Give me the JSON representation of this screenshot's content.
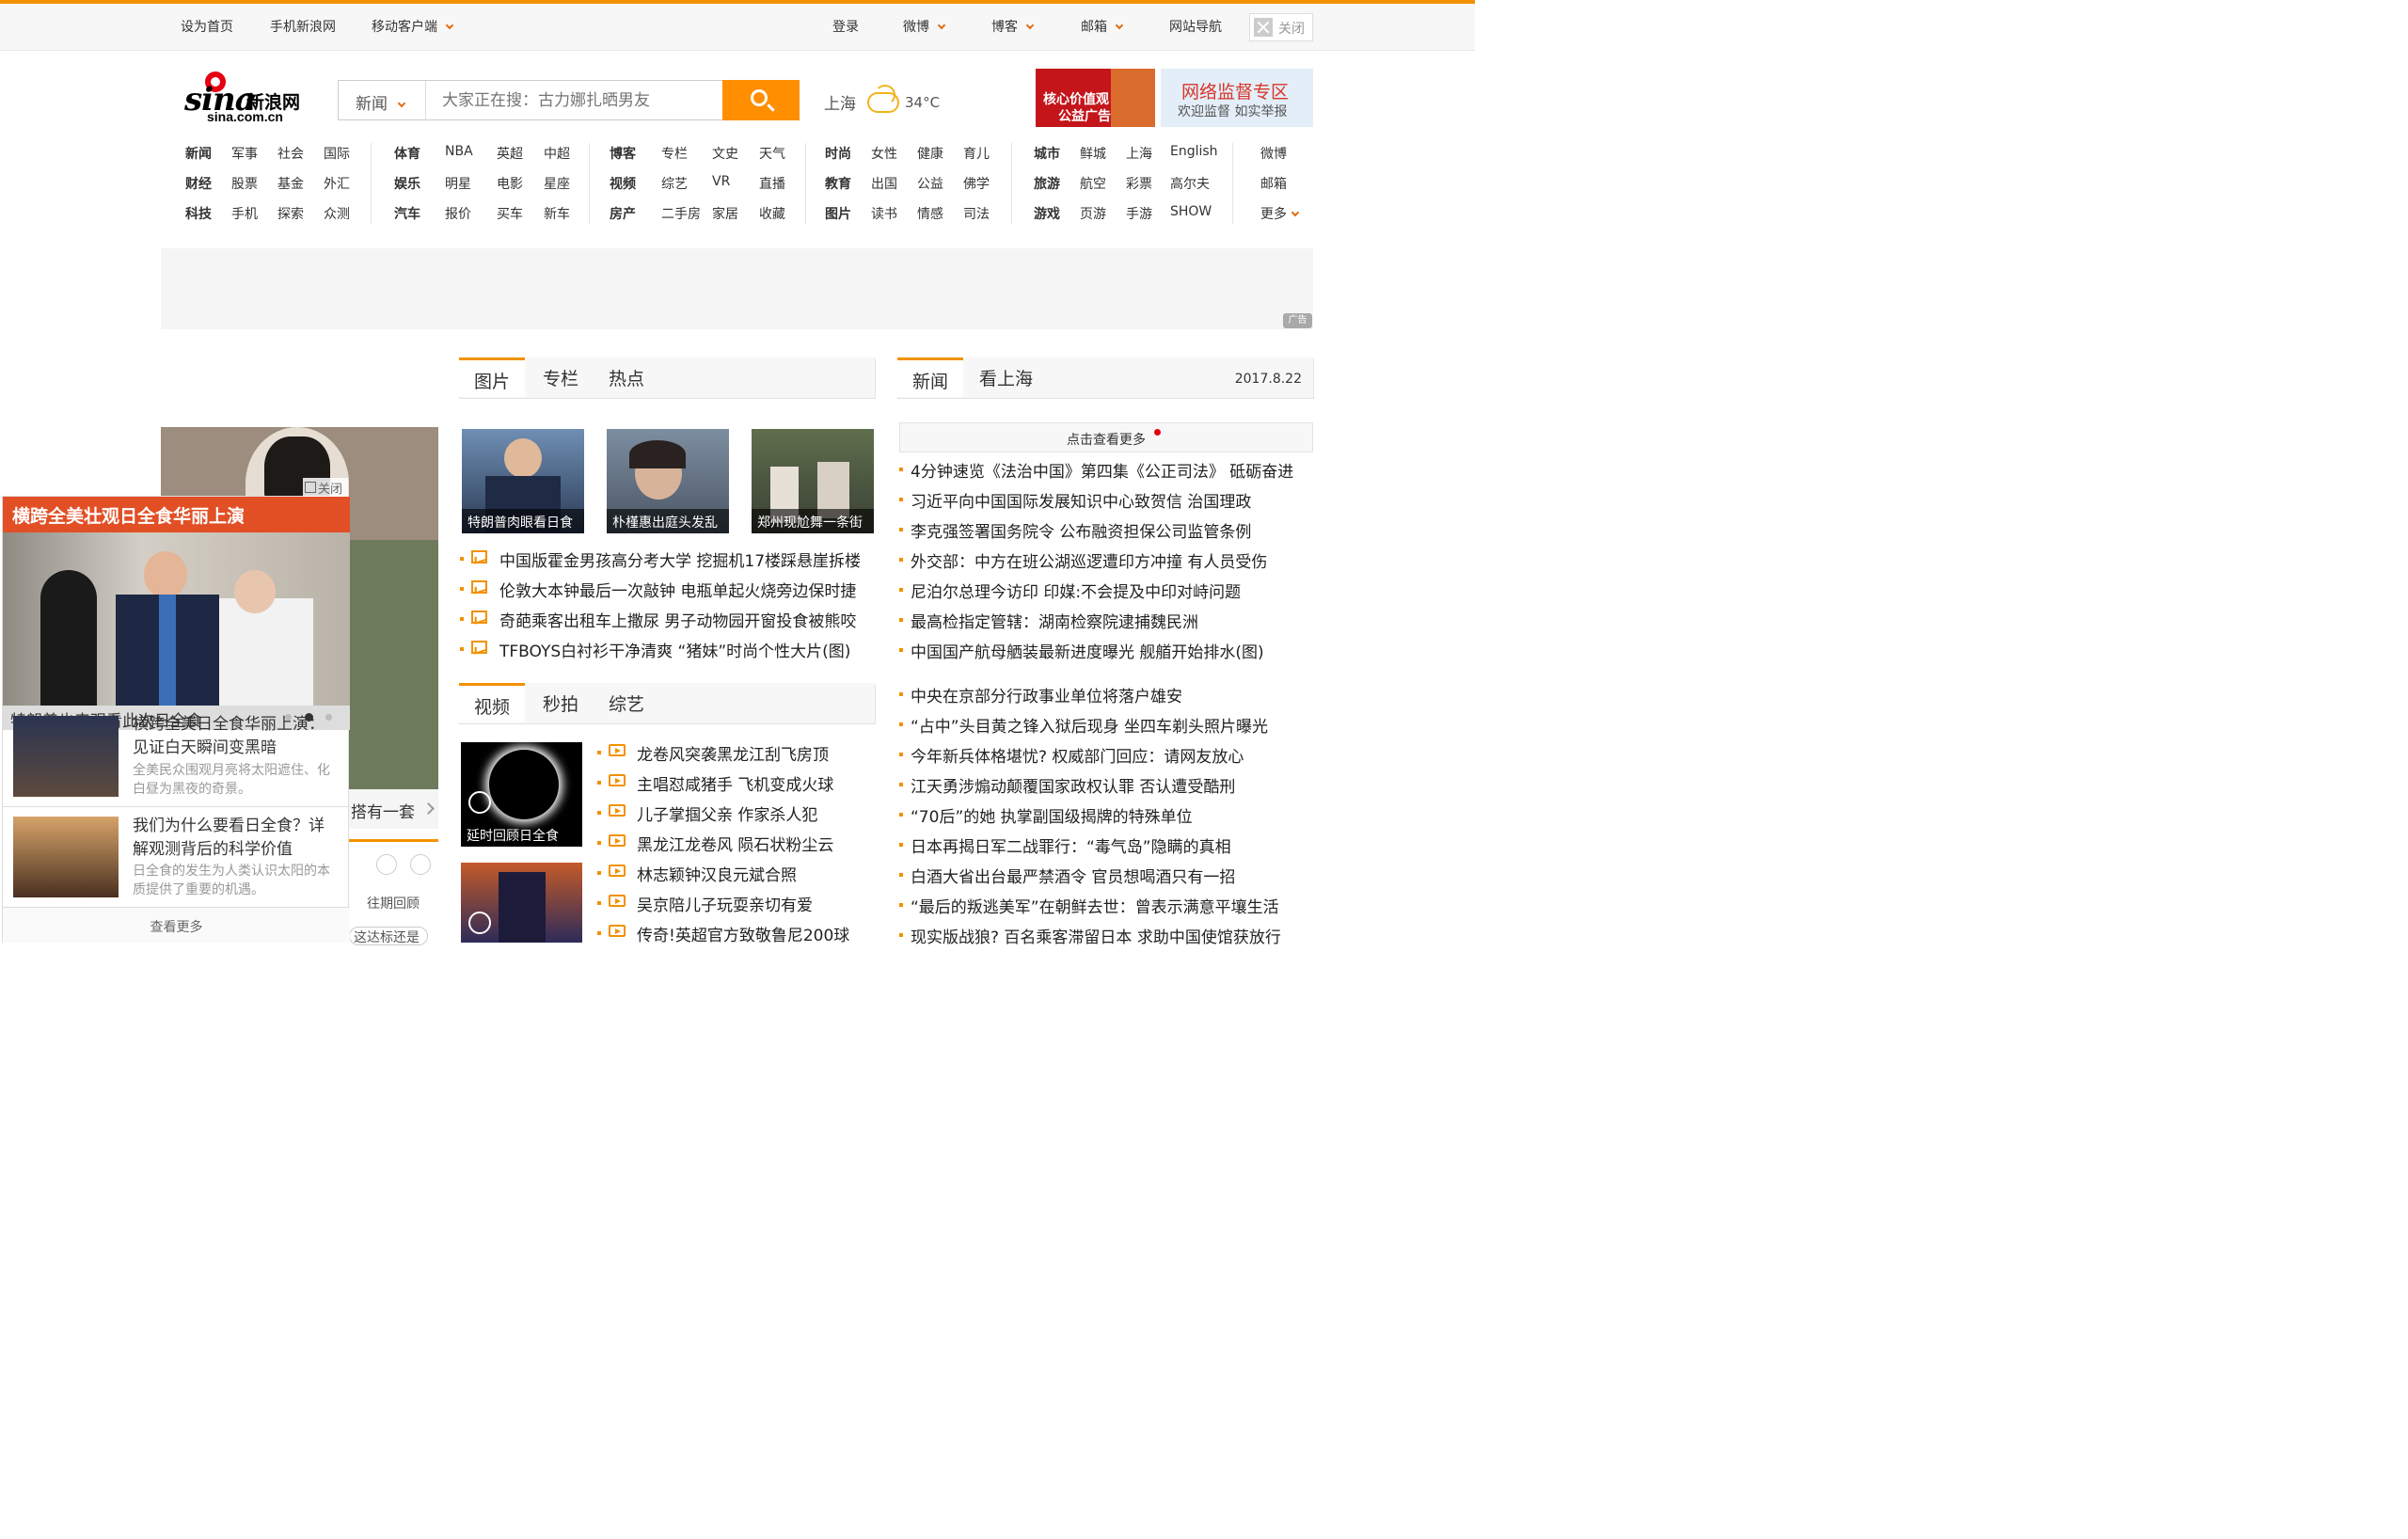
{
  "colors": {
    "accent": "#f29100",
    "brand_red": "#e60012",
    "popup_red": "#e24f25",
    "search_btn": "#ff8f00"
  },
  "topbar": {
    "links": [
      "设为首页",
      "手机新浪网",
      "移动客户端"
    ],
    "right": [
      "登录",
      "微博",
      "博客",
      "邮箱",
      "网站导航"
    ],
    "close": "关闭"
  },
  "logo": {
    "cn": "新浪网",
    "en": "sina",
    "domain": "sina.com.cn"
  },
  "search": {
    "category": "新闻",
    "placeholder": "大家正在搜：古力娜扎晒男友",
    "icon": "search-icon"
  },
  "weather": {
    "city": "上海",
    "temp": "34°C",
    "icon": "cloud-rain-icon"
  },
  "ads": {
    "ad1_line1": "核心价值观",
    "ad1_line2": "公益广告",
    "ad2_title": "网络监督专区",
    "ad2_sub": "欢迎监督 如实举报",
    "tag": "广告"
  },
  "nav": {
    "g1": [
      [
        "新闻",
        "军事",
        "社会",
        "国际"
      ],
      [
        "财经",
        "股票",
        "基金",
        "外汇"
      ],
      [
        "科技",
        "手机",
        "探索",
        "众测"
      ]
    ],
    "g2": [
      [
        "体育",
        "NBA",
        "英超",
        "中超"
      ],
      [
        "娱乐",
        "明星",
        "电影",
        "星座"
      ],
      [
        "汽车",
        "报价",
        "买车",
        "新车"
      ]
    ],
    "g3": [
      [
        "博客",
        "专栏",
        "文史",
        "天气"
      ],
      [
        "视频",
        "综艺",
        "VR",
        "直播"
      ],
      [
        "房产",
        "二手房",
        "家居",
        "收藏"
      ]
    ],
    "g4": [
      [
        "时尚",
        "女性",
        "健康",
        "育儿"
      ],
      [
        "教育",
        "出国",
        "公益",
        "佛学"
      ],
      [
        "图片",
        "读书",
        "情感",
        "司法"
      ]
    ],
    "g5": [
      [
        "城市",
        "鲜城",
        "上海",
        "English"
      ],
      [
        "旅游",
        "航空",
        "彩票",
        "高尔夫"
      ],
      [
        "游戏",
        "页游",
        "手游",
        "SHOW"
      ]
    ],
    "g6": [
      "微博",
      "邮箱",
      "更多"
    ]
  },
  "mid": {
    "tabs": [
      "图片",
      "专栏",
      "热点"
    ],
    "thumbs": [
      "特朗普肉眼看日食",
      "朴槿惠出庭头发乱",
      "郑州现尬舞一条街"
    ],
    "photo_list": [
      "中国版霍金男孩高分考大学 挖掘机17楼踩悬崖拆楼",
      "伦敦大本钟最后一次敲钟 电瓶单起火烧旁边保时捷",
      "奇葩乘客出租车上撒尿 男子动物园开窗投食被熊咬",
      "TFBOYS白衬衫干净清爽 “猪妹”时尚个性大片(图)"
    ],
    "vtabs": [
      "视频",
      "秒拍",
      "综艺"
    ],
    "vthumb": "延时回顾日全食",
    "video_list": [
      "龙卷风突袭黑龙江刮飞房顶",
      "主唱怼咸猪手 飞机变成火球",
      "儿子掌掴父亲 作家杀人犯",
      "黑龙江龙卷风 陨石状粉尘云",
      "林志颖钟汉良元斌合照",
      "吴京陪儿子玩耍亲切有爱",
      "传奇!英超官方致敬鲁尼200球"
    ]
  },
  "right": {
    "tabs": [
      "新闻",
      "看上海"
    ],
    "date": "2017.8.22",
    "more": "点击查看更多",
    "news1": [
      "4分钟速览《法治中国》第四集《公正司法》 砥砺奋进",
      "习近平向中国国际发展知识中心致贺信 治国理政",
      "李克强签署国务院令 公布融资担保公司监管条例",
      "外交部：中方在班公湖巡逻遭印方冲撞 有人员受伤",
      "尼泊尔总理今访印 印媒:不会提及中印对峙问题",
      "最高检指定管辖：湖南检察院逮捕魏民洲",
      "中国国产航母舾装最新进度曝光 舰艏开始排水(图)"
    ],
    "news2": [
      "中央在京部分行政事业单位将落户雄安",
      "“占中”头目黄之锋入狱后现身 坐四车剃头照片曝光",
      "今年新兵体格堪忧? 权威部门回应：请网友放心",
      "江天勇涉煽动颠覆国家政权认罪 否认遭受酷刑",
      "“70后”的她 执掌副国级揭牌的特殊单位",
      "日本再揭日军二战罪行：“毒气岛”隐瞒的真相",
      "白酒大省出台最严禁酒令 官员想喝酒只有一招",
      "“最后的叛逃美军”在朝鲜去世：曾表示满意平壤生活",
      "现实版战狼? 百名乘客滞留日本 求助中国使馆获放行"
    ]
  },
  "popup": {
    "title": "横跨全美壮观日全食华丽上演",
    "close": "关闭",
    "caption": "特朗普也来观看此次日全食",
    "item1_title": "横跨全美日全食华丽上演：见证白天瞬间变黑暗",
    "item1_desc": "全美民众围观月亮将太阳遮住、化白昼为黑夜的奇景。",
    "item2_title": "我们为什么要看日全食？详解观测背后的科学价值",
    "item2_desc": "日全食的发生为人类认识太阳的本质提供了重要的机遇。",
    "more": "查看更多"
  },
  "leftbg": {
    "side_text": "搭有一套",
    "past": "往期回顾",
    "bottom": "这达标还是"
  }
}
